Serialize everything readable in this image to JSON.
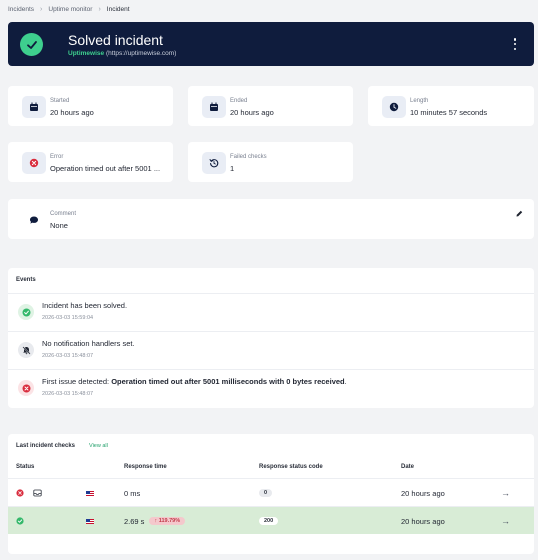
{
  "breadcrumb": {
    "items": [
      "Incidents",
      "Uptime monitor",
      "Incident"
    ]
  },
  "hero": {
    "title": "Solved incident",
    "brand": "Uptimewise",
    "url": "(https://uptimewise.com)",
    "status_color": "#3ecf8e",
    "icon": "check-icon"
  },
  "stats": {
    "started": {
      "label": "Started",
      "value": "20 hours ago",
      "icon": "calendar-icon"
    },
    "ended": {
      "label": "Ended",
      "value": "20 hours ago",
      "icon": "calendar-icon"
    },
    "length": {
      "label": "Length",
      "value": "10 minutes 57 seconds",
      "icon": "clock-icon"
    },
    "error": {
      "label": "Error",
      "value": "Operation timed out after 5001 ...",
      "icon": "error-icon"
    },
    "failed": {
      "label": "Failed checks",
      "value": "1",
      "icon": "history-icon"
    }
  },
  "comment": {
    "label": "Comment",
    "value": "None",
    "icon": "chat-icon"
  },
  "events": {
    "title": "Events",
    "items": [
      {
        "message": "Incident has been solved.",
        "timestamp": "2026-03-03 15:59:04",
        "icon": "check-icon"
      },
      {
        "message": "No notification handlers set.",
        "timestamp": "2026-03-03 15:48:07",
        "icon": "bell-off-icon"
      },
      {
        "message_prefix": "First issue detected: ",
        "message_bold": "Operation timed out after 5001 milliseconds with 0 bytes received",
        "message_suffix": ".",
        "timestamp": "2026-03-03 15:48:07",
        "icon": "error-icon"
      }
    ]
  },
  "checks": {
    "title": "Last incident checks",
    "view_all": "View all",
    "columns": [
      "Status",
      "Response time",
      "Response status code",
      "Date"
    ],
    "rows": [
      {
        "status": "failed",
        "response_time": "0 ms",
        "status_code": "0",
        "date": "20 hours ago"
      },
      {
        "status": "ok",
        "response_time": "2.69 s",
        "change": "↑ 119.79%",
        "status_code": "200",
        "date": "20 hours ago"
      }
    ]
  },
  "colors": {
    "navy": "#0f1c3d",
    "success": "#3ecf8e",
    "error": "#d92d3e",
    "link": "#22a06b"
  }
}
